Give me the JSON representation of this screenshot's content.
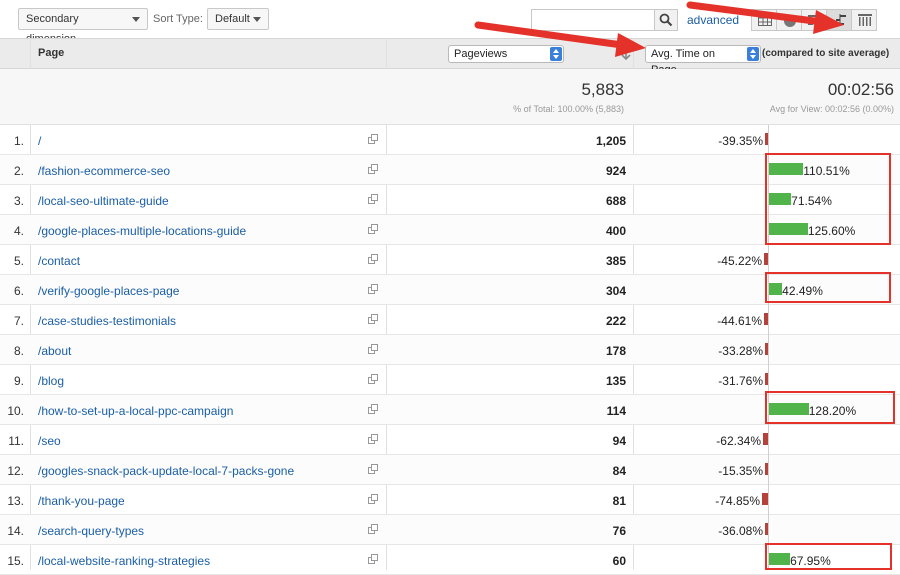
{
  "toolbar": {
    "secondary_dimension": "Secondary dimension",
    "sort_type_label": "Sort Type:",
    "sort_type_value": "Default",
    "search_value": "",
    "advanced_label": "advanced"
  },
  "table": {
    "header_page": "Page",
    "metric_select": "Pageviews",
    "compare_select": "Avg. Time on Page",
    "compare_label": "(compared to site average)",
    "totals": {
      "pageviews": "5,883",
      "pageviews_sub": "% of Total: 100.00% (5,883)",
      "avg_time": "00:02:56",
      "avg_time_sub": "Avg for View: 00:02:56 (0.00%)"
    },
    "rows": [
      {
        "num": "1.",
        "page": "/",
        "pageviews": "1,205",
        "pct_label": "-39.35%",
        "pct": -39.35
      },
      {
        "num": "2.",
        "page": "/fashion-ecommerce-seo",
        "pageviews": "924",
        "pct_label": "110.51%",
        "pct": 110.51
      },
      {
        "num": "3.",
        "page": "/local-seo-ultimate-guide",
        "pageviews": "688",
        "pct_label": "71.54%",
        "pct": 71.54
      },
      {
        "num": "4.",
        "page": "/google-places-multiple-locations-guide",
        "pageviews": "400",
        "pct_label": "125.60%",
        "pct": 125.6
      },
      {
        "num": "5.",
        "page": "/contact",
        "pageviews": "385",
        "pct_label": "-45.22%",
        "pct": -45.22
      },
      {
        "num": "6.",
        "page": "/verify-google-places-page",
        "pageviews": "304",
        "pct_label": "42.49%",
        "pct": 42.49
      },
      {
        "num": "7.",
        "page": "/case-studies-testimonials",
        "pageviews": "222",
        "pct_label": "-44.61%",
        "pct": -44.61
      },
      {
        "num": "8.",
        "page": "/about",
        "pageviews": "178",
        "pct_label": "-33.28%",
        "pct": -33.28
      },
      {
        "num": "9.",
        "page": "/blog",
        "pageviews": "135",
        "pct_label": "-31.76%",
        "pct": -31.76
      },
      {
        "num": "10.",
        "page": "/how-to-set-up-a-local-ppc-campaign",
        "pageviews": "114",
        "pct_label": "128.20%",
        "pct": 128.2
      },
      {
        "num": "11.",
        "page": "/seo",
        "pageviews": "94",
        "pct_label": "-62.34%",
        "pct": -62.34
      },
      {
        "num": "12.",
        "page": "/googles-snack-pack-update-local-7-packs-gone",
        "pageviews": "84",
        "pct_label": "-15.35%",
        "pct": -15.35
      },
      {
        "num": "13.",
        "page": "/thank-you-page",
        "pageviews": "81",
        "pct_label": "-74.85%",
        "pct": -74.85
      },
      {
        "num": "14.",
        "page": "/search-query-types",
        "pageviews": "76",
        "pct_label": "-36.08%",
        "pct": -36.08
      },
      {
        "num": "15.",
        "page": "/local-website-ranking-strategies",
        "pageviews": "60",
        "pct_label": "67.95%",
        "pct": 67.95
      }
    ]
  },
  "colors": {
    "positive_bar": "#50b44a",
    "negative_bar": "#b5413b",
    "annotation": "#e4322b",
    "link": "#1a5ea4"
  },
  "icons": [
    "search-icon",
    "table-view-icon",
    "pie-view-icon",
    "performance-view-icon",
    "comparison-view-icon",
    "pivot-view-icon",
    "external-link-icon",
    "sort-arrow-icon"
  ]
}
